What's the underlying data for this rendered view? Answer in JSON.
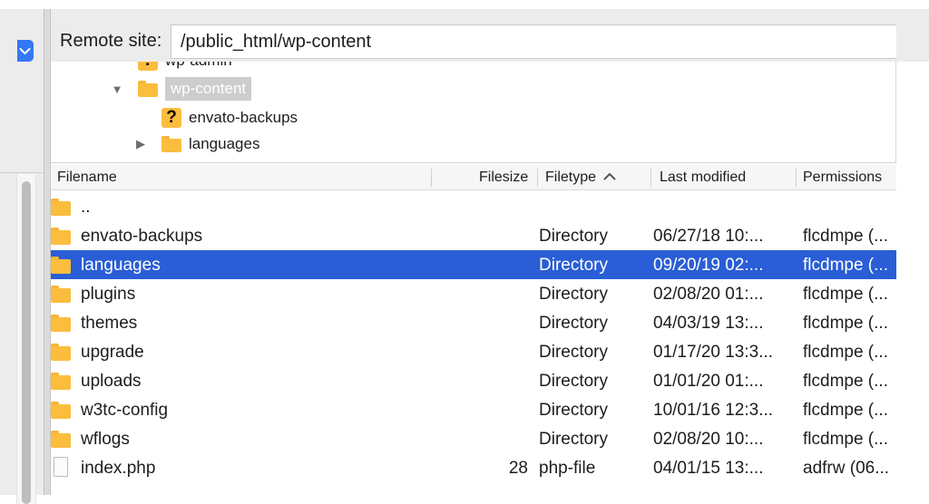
{
  "remote": {
    "label": "Remote site:",
    "path": "/public_html/wp-content"
  },
  "tree": [
    {
      "label": "wp-admin",
      "icon": "question-folder-icon"
    },
    {
      "label": "wp-content",
      "icon": "folder-icon",
      "arrow": "▼"
    },
    {
      "label": "envato-backups",
      "icon": "question-folder-icon"
    },
    {
      "label": "languages",
      "icon": "folder-icon",
      "arrow": "▶"
    }
  ],
  "columns": {
    "filename": "Filename",
    "filesize": "Filesize",
    "filetype": "Filetype",
    "last_modified": "Last modified",
    "permissions": "Permissions"
  },
  "files": [
    {
      "name": "..",
      "size": "",
      "type": "",
      "modified": "",
      "permissions": "",
      "icon": "folder-icon"
    },
    {
      "name": "envato-backups",
      "size": "",
      "type": "Directory",
      "modified": "06/27/18 10:...",
      "permissions": "flcdmpe (...",
      "icon": "folder-icon"
    },
    {
      "name": "languages",
      "size": "",
      "type": "Directory",
      "modified": "09/20/19 02:...",
      "permissions": "flcdmpe (...",
      "icon": "folder-icon"
    },
    {
      "name": "plugins",
      "size": "",
      "type": "Directory",
      "modified": "02/08/20 01:...",
      "permissions": "flcdmpe (...",
      "icon": "folder-icon"
    },
    {
      "name": "themes",
      "size": "",
      "type": "Directory",
      "modified": "04/03/19 13:...",
      "permissions": "flcdmpe (...",
      "icon": "folder-icon"
    },
    {
      "name": "upgrade",
      "size": "",
      "type": "Directory",
      "modified": "01/17/20 13:3...",
      "permissions": "flcdmpe (...",
      "icon": "folder-icon"
    },
    {
      "name": "uploads",
      "size": "",
      "type": "Directory",
      "modified": "01/01/20 01:...",
      "permissions": "flcdmpe (...",
      "icon": "folder-icon"
    },
    {
      "name": "w3tc-config",
      "size": "",
      "type": "Directory",
      "modified": "10/01/16 12:3...",
      "permissions": "flcdmpe (...",
      "icon": "folder-icon"
    },
    {
      "name": "wflogs",
      "size": "",
      "type": "Directory",
      "modified": "02/08/20 10:...",
      "permissions": "flcdmpe (...",
      "icon": "folder-icon"
    },
    {
      "name": "index.php",
      "size": "28",
      "type": "php-file",
      "modified": "04/01/15 13:...",
      "permissions": "adfrw (06...",
      "icon": "file-icon"
    }
  ],
  "selected_file": "languages",
  "colors": {
    "selection": "#2a5ed6",
    "folder": "#fbbd3d",
    "accent": "#3478f6"
  }
}
